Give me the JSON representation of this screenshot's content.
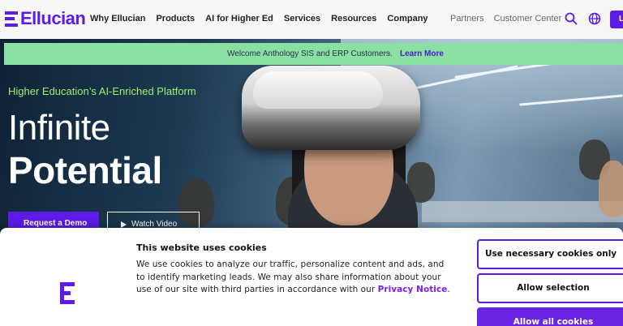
{
  "header": {
    "logo_text": "Ellucian",
    "nav_items": [
      {
        "label": "Why Ellucian"
      },
      {
        "label": "Products"
      },
      {
        "label": "AI for Higher Ed"
      },
      {
        "label": "Services"
      },
      {
        "label": "Resources"
      },
      {
        "label": "Company"
      }
    ],
    "utility_links": [
      {
        "label": "Partners"
      },
      {
        "label": "Customer Center"
      }
    ],
    "login_label": "L",
    "icons": [
      "search-icon",
      "globe-icon"
    ]
  },
  "banner": {
    "text": "Welcome Anthology SIS and ERP Customers.",
    "link_label": "Learn More"
  },
  "hero": {
    "eyebrow": "Higher Education’s AI-Enriched Platform",
    "title_line1": "Infinite",
    "title_line2": "Potential",
    "primary_button": "Request a Demo",
    "secondary_button": "Watch Video"
  },
  "cookie_banner": {
    "title": "This website uses cookies",
    "body": "We use cookies to analyze our traffic, personalize content and ads, and to identify marketing leads. We may also share information about your use of our site with third parties in accordance with our ",
    "link_label": "Privacy Notice",
    "body_end": ".",
    "buttons": {
      "necessary": "Use necessary cookies only",
      "selection": "Allow selection",
      "all": "Allow all cookies"
    }
  },
  "colors": {
    "brand_purple": "#5c1be6",
    "banner_green": "#8be0a4",
    "eyebrow_green": "#a6eb6e"
  }
}
